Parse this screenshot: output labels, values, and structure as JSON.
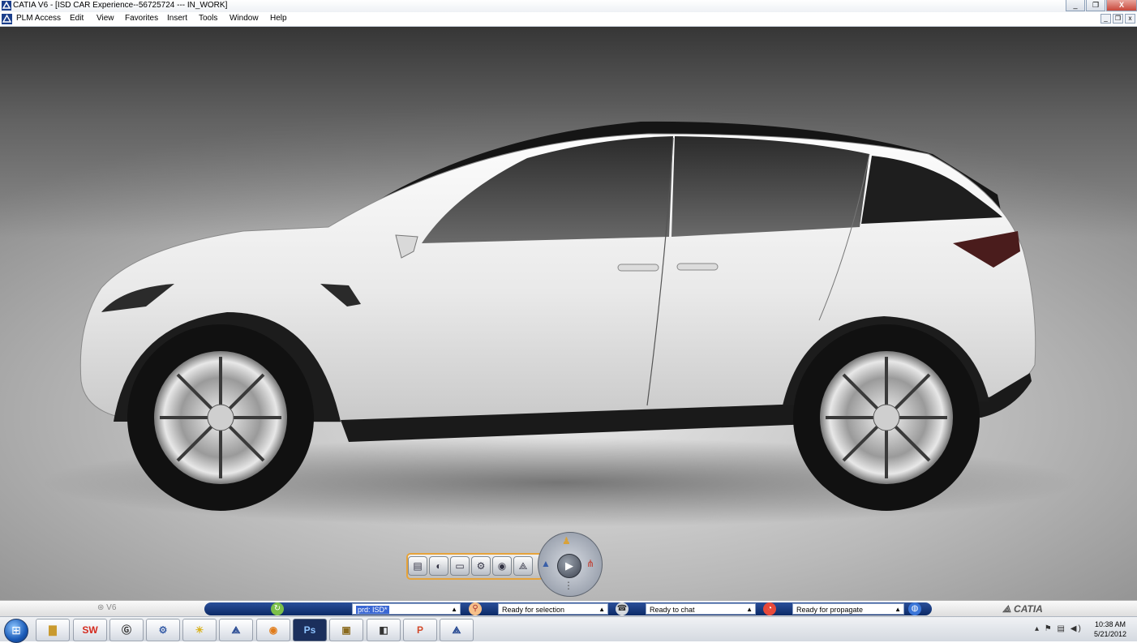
{
  "window": {
    "title": "CATIA V6 - [ISD CAR Experience--56725724 --- IN_WORK]",
    "controls": {
      "minimize": "_",
      "restore": "❐",
      "close": "X"
    }
  },
  "menu": {
    "items": [
      "PLM Access",
      "Edit",
      "View",
      "Favorites",
      "Insert",
      "Tools",
      "Window",
      "Help"
    ]
  },
  "status": {
    "version": "V6",
    "product_field": "prd: ISD*",
    "selection_status": "Ready for selection",
    "chat_status": "Ready to chat",
    "propagate_status": "Ready for propagate",
    "brand": "CATIA"
  },
  "taskbar": {
    "apps": [
      "explorer",
      "SW",
      "G",
      "gear",
      "lamp",
      "3DS",
      "firefox",
      "Ps",
      "media",
      "render",
      "P",
      "3DS"
    ],
    "labels": {
      "sw": "SW",
      "ps": "Ps",
      "ppt": "P"
    },
    "clock_time": "10:38 AM",
    "clock_date": "5/21/2012"
  },
  "colors": {
    "accent_blue": "#0c2a66",
    "toolbar_orange": "#e6a33a",
    "car_body": "#f2f2f2"
  }
}
